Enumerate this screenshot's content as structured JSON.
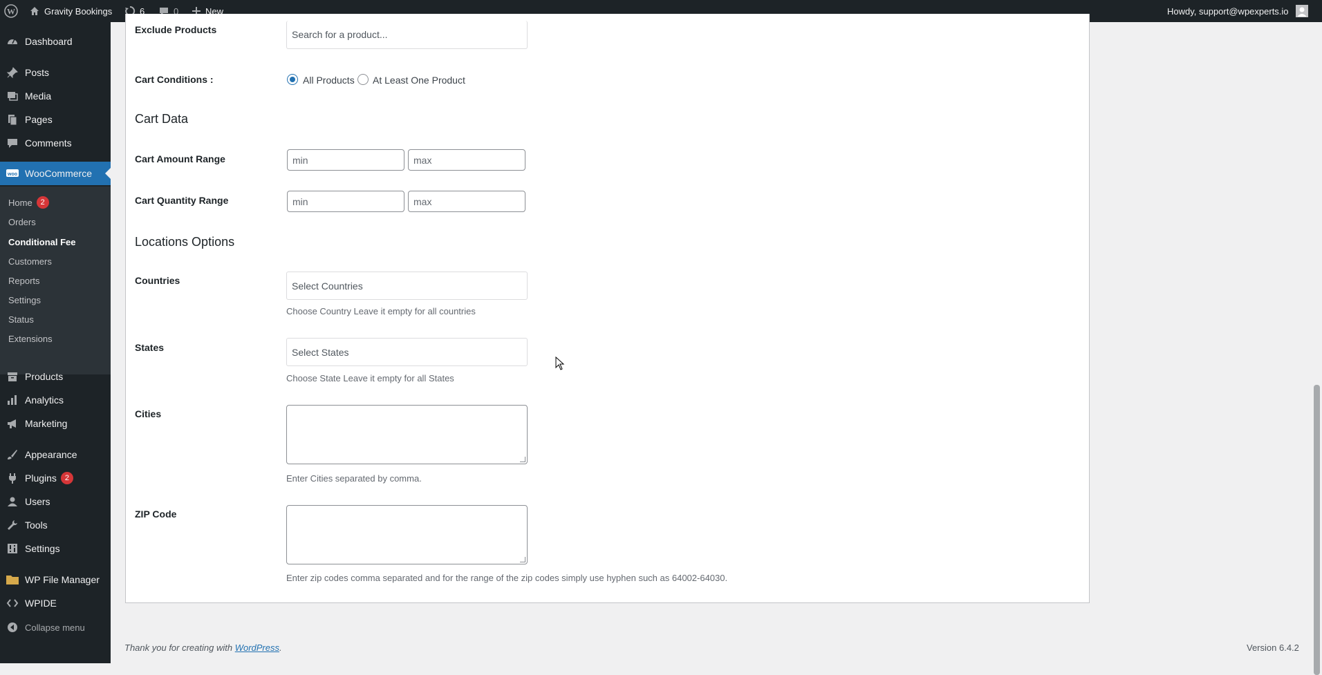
{
  "admin_bar": {
    "wp_logo": "wordpress-icon",
    "site_name": "Gravity Bookings",
    "updates_count": "6",
    "comments_count": "0",
    "new_label": "New",
    "greeting": "Howdy, support@wpexperts.io"
  },
  "sidebar": {
    "items": [
      {
        "label": "Dashboard",
        "icon": "dashboard-icon"
      },
      {
        "label": "Posts",
        "icon": "pin-icon"
      },
      {
        "label": "Media",
        "icon": "media-icon"
      },
      {
        "label": "Pages",
        "icon": "pages-icon"
      },
      {
        "label": "Comments",
        "icon": "comments-icon"
      },
      {
        "label": "WooCommerce",
        "icon": "woocommerce-icon"
      },
      {
        "label": "Products",
        "icon": "archive-icon"
      },
      {
        "label": "Analytics",
        "icon": "bar-chart-icon"
      },
      {
        "label": "Marketing",
        "icon": "megaphone-icon"
      },
      {
        "label": "Appearance",
        "icon": "paintbrush-icon"
      },
      {
        "label": "Plugins",
        "icon": "plugin-icon",
        "badge": "2"
      },
      {
        "label": "Users",
        "icon": "user-icon"
      },
      {
        "label": "Tools",
        "icon": "wrench-icon"
      },
      {
        "label": "Settings",
        "icon": "settings-icon"
      },
      {
        "label": "WP File Manager",
        "icon": "folder-icon"
      },
      {
        "label": "WPIDE",
        "icon": "code-icon"
      },
      {
        "label": "Collapse menu",
        "icon": "collapse-icon"
      }
    ],
    "woo_submenu": [
      {
        "label": "Home",
        "badge": "2"
      },
      {
        "label": "Orders"
      },
      {
        "label": "Conditional Fee",
        "current": true
      },
      {
        "label": "Customers"
      },
      {
        "label": "Reports"
      },
      {
        "label": "Settings"
      },
      {
        "label": "Status"
      },
      {
        "label": "Extensions"
      }
    ]
  },
  "form": {
    "exclude_products": {
      "label": "Exclude Products",
      "placeholder": "Search for a product..."
    },
    "cart_conditions": {
      "label": "Cart Conditions :",
      "options": [
        "All Products",
        "At Least One Product"
      ],
      "selected": "All Products"
    },
    "cart_data_title": "Cart Data",
    "cart_amount_range": {
      "label": "Cart Amount Range",
      "min_placeholder": "min",
      "max_placeholder": "max"
    },
    "cart_quantity_range": {
      "label": "Cart Quantity Range",
      "min_placeholder": "min",
      "max_placeholder": "max"
    },
    "locations_title": "Locations Options",
    "countries": {
      "label": "Countries",
      "placeholder": "Select Countries",
      "description": "Choose Country Leave it empty for all countries"
    },
    "states": {
      "label": "States",
      "placeholder": "Select States",
      "description": "Choose State Leave it empty for all States"
    },
    "cities": {
      "label": "Cities",
      "description": "Enter Cities separated by comma."
    },
    "zip_code": {
      "label": "ZIP Code",
      "description": "Enter zip codes comma separated and for the range of the zip codes simply use hyphen such as 64002-64030."
    }
  },
  "footer": {
    "thanks_prefix": "Thank you for creating with ",
    "wordpress_link": "WordPress",
    "thanks_suffix": ".",
    "version": "Version 6.4.2"
  },
  "colors": {
    "admin_dark": "#1d2327",
    "accent": "#2271b1",
    "badge_red": "#d63638"
  }
}
